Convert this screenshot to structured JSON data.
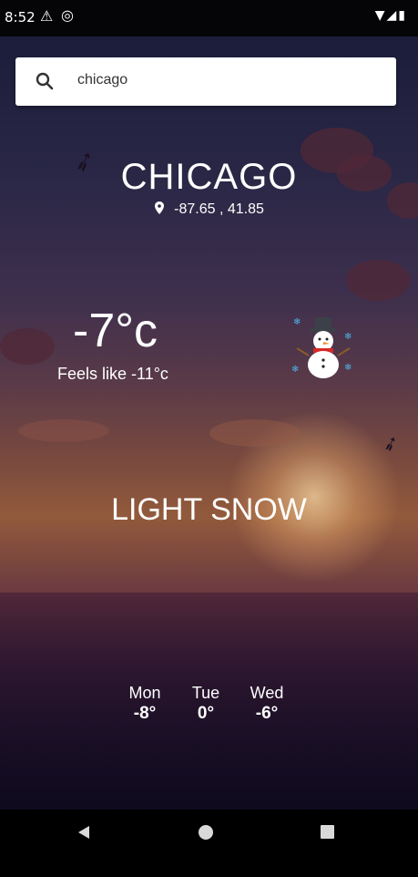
{
  "status": {
    "time": "8:52"
  },
  "search": {
    "value": "chicago"
  },
  "location": {
    "city": "CHICAGO",
    "coords": "-87.65 , 41.85"
  },
  "current": {
    "temp": "-7°c",
    "feels_like": "Feels like -11°c",
    "condition": "LIGHT SNOW",
    "icon": "snowman-icon"
  },
  "forecast": [
    {
      "day": "Mon",
      "temp": "-8°"
    },
    {
      "day": "Tue",
      "temp": "0°"
    },
    {
      "day": "Wed",
      "temp": "-6°"
    }
  ]
}
